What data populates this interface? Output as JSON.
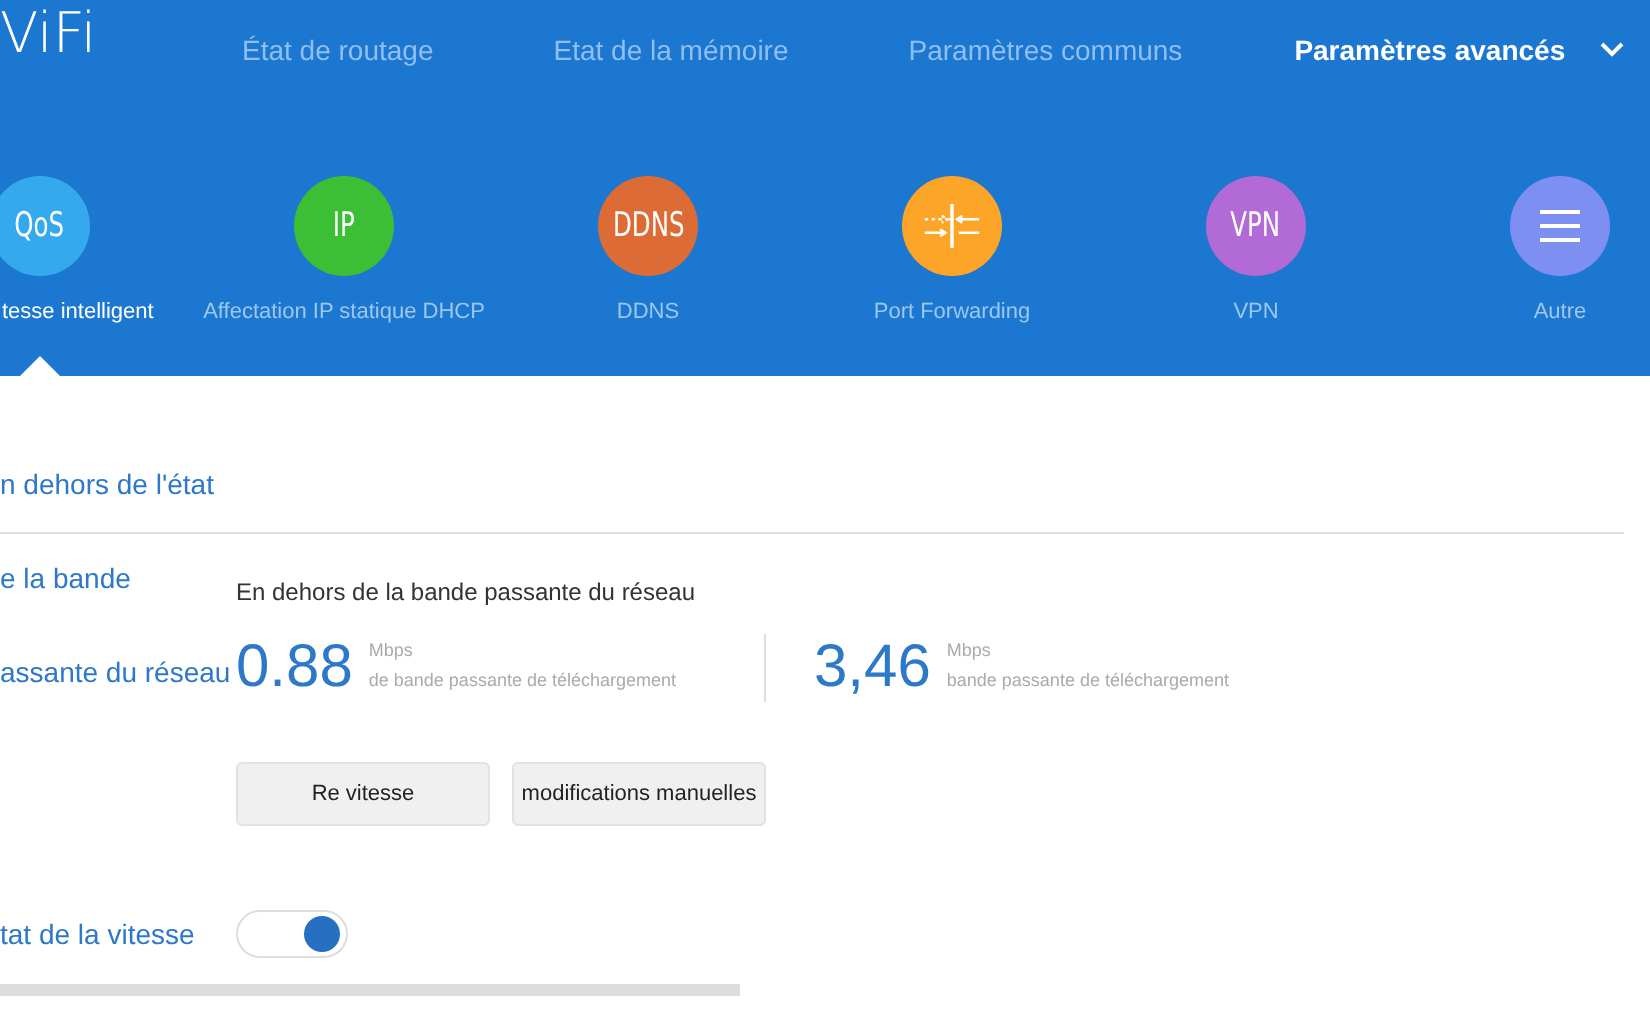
{
  "logo": "ViFi",
  "nav": [
    {
      "label": "État de routage",
      "selected": false
    },
    {
      "label": "Etat de la mémoire",
      "selected": false
    },
    {
      "label": "Paramètres communs",
      "selected": false
    },
    {
      "label": "Paramètres avancés",
      "selected": true
    }
  ],
  "features": [
    {
      "kind": "text",
      "glyph": "QoS",
      "label": "tesse intelligent",
      "color": "#35a9ee",
      "selected": true
    },
    {
      "kind": "text",
      "glyph": "IP",
      "label": "Affectation IP statique DHCP",
      "color": "#3cbf34",
      "selected": false
    },
    {
      "kind": "text",
      "glyph": "DDNS",
      "label": "DDNS",
      "color": "#dd6b35",
      "selected": false
    },
    {
      "kind": "ports",
      "label": "Port Forwarding",
      "color": "#fda528",
      "selected": false
    },
    {
      "kind": "text",
      "glyph": "VPN",
      "label": "VPN",
      "color": "#b16ad6",
      "selected": false
    },
    {
      "kind": "menu",
      "label": "Autre",
      "color": "#7d8ff0",
      "selected": false
    }
  ],
  "section_title": "n dehors de l'état",
  "bandwidth": {
    "label_1": "e la bande",
    "label_2": "assante du réseau",
    "heading": "En dehors de la bande passante du réseau",
    "readings": [
      {
        "value": "0.88",
        "unit": "Mbps",
        "caption": "de bande passante de téléchargement"
      },
      {
        "value": "3,46",
        "unit": "Mbps",
        "caption": "bande passante de téléchargement"
      }
    ]
  },
  "buttons": [
    "Re vitesse",
    "modifications manuelles"
  ],
  "speed_state": {
    "label": "tat de la vitesse",
    "on": true
  }
}
